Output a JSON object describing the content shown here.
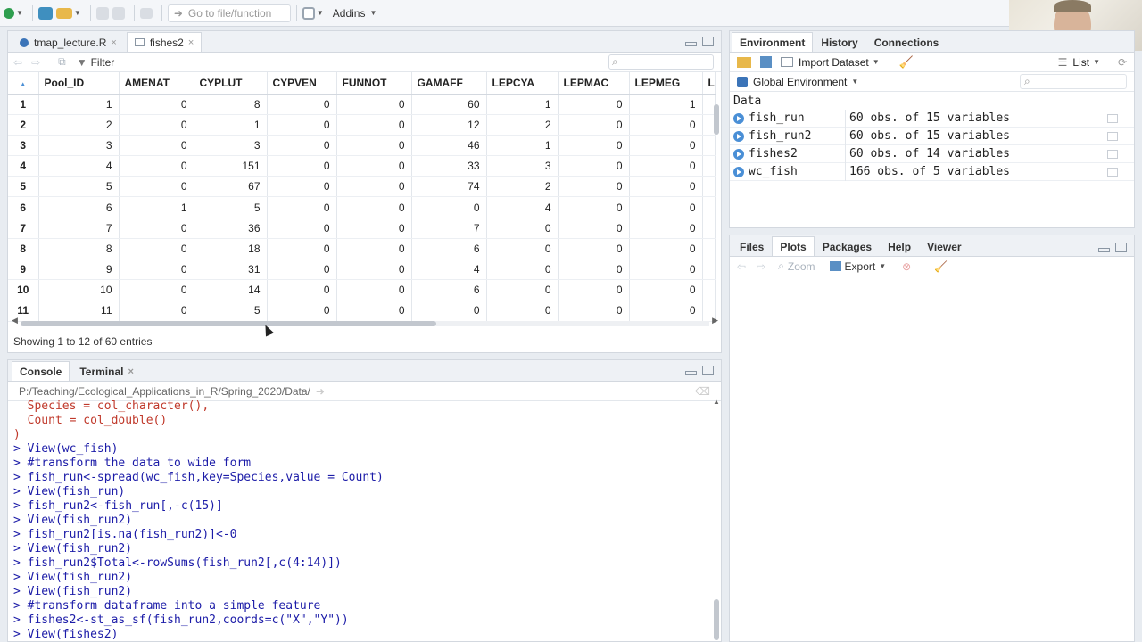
{
  "toolbar": {
    "goto_placeholder": "Go to file/function",
    "addins_label": "Addins"
  },
  "source": {
    "tabs": [
      {
        "label": "tmap_lecture.R",
        "active": false
      },
      {
        "label": "fishes2",
        "active": true
      }
    ],
    "filter_label": "Filter",
    "columns": [
      "Pool_ID",
      "AMENAT",
      "CYPLUT",
      "CYPVEN",
      "FUNNOT",
      "GAMAFF",
      "LEPCYA",
      "LEPMAC",
      "LEPMEG",
      "LEPM"
    ],
    "rows": [
      [
        "1",
        "1",
        "0",
        "8",
        "0",
        "0",
        "60",
        "1",
        "0",
        "1"
      ],
      [
        "2",
        "2",
        "0",
        "1",
        "0",
        "0",
        "12",
        "2",
        "0",
        "0"
      ],
      [
        "3",
        "3",
        "0",
        "3",
        "0",
        "0",
        "46",
        "1",
        "0",
        "0"
      ],
      [
        "4",
        "4",
        "0",
        "151",
        "0",
        "0",
        "33",
        "3",
        "0",
        "0"
      ],
      [
        "5",
        "5",
        "0",
        "67",
        "0",
        "0",
        "74",
        "2",
        "0",
        "0"
      ],
      [
        "6",
        "6",
        "1",
        "5",
        "0",
        "0",
        "0",
        "4",
        "0",
        "0"
      ],
      [
        "7",
        "7",
        "0",
        "36",
        "0",
        "0",
        "7",
        "0",
        "0",
        "0"
      ],
      [
        "8",
        "8",
        "0",
        "18",
        "0",
        "0",
        "6",
        "0",
        "0",
        "0"
      ],
      [
        "9",
        "9",
        "0",
        "31",
        "0",
        "0",
        "4",
        "0",
        "0",
        "0"
      ],
      [
        "10",
        "10",
        "0",
        "14",
        "0",
        "0",
        "6",
        "0",
        "0",
        "0"
      ],
      [
        "11",
        "11",
        "0",
        "5",
        "0",
        "0",
        "0",
        "0",
        "0",
        "0"
      ]
    ],
    "entries_text": "Showing 1 to 12 of 60 entries"
  },
  "console": {
    "tabs": [
      {
        "label": "Console",
        "active": true
      },
      {
        "label": "Terminal",
        "active": false
      }
    ],
    "path": "P:/Teaching/Ecological_Applications_in_R/Spring_2020/Data/",
    "lines": [
      "  Species = col_character(),",
      "  Count = col_double()",
      ")",
      "> View(wc_fish)",
      "> #transform the data to wide form",
      "> fish_run<-spread(wc_fish,key=Species,value = Count)",
      "> View(fish_run)",
      "> fish_run2<-fish_run[,-c(15)]",
      "> View(fish_run2)",
      "> fish_run2[is.na(fish_run2)]<-0",
      "> View(fish_run2)",
      "> fish_run2$Total<-rowSums(fish_run2[,c(4:14)])",
      "> View(fish_run2)",
      "> View(fish_run2)",
      "> #transform dataframe into a simple feature",
      "> fishes2<-st_as_sf(fish_run2,coords=c(\"X\",\"Y\"))",
      "> View(fishes2)"
    ]
  },
  "environment": {
    "tabs": [
      {
        "label": "Environment",
        "active": true
      },
      {
        "label": "History",
        "active": false
      },
      {
        "label": "Connections",
        "active": false
      }
    ],
    "import_label": "Import Dataset",
    "view_mode": "List",
    "scope": "Global Environment",
    "section": "Data",
    "objects": [
      {
        "name": "fish_run",
        "value": "60 obs. of 15 variables"
      },
      {
        "name": "fish_run2",
        "value": "60 obs. of 15 variables"
      },
      {
        "name": "fishes2",
        "value": "60 obs. of 14 variables"
      },
      {
        "name": "wc_fish",
        "value": "166 obs. of 5 variables"
      }
    ]
  },
  "plots": {
    "tabs": [
      {
        "label": "Files",
        "active": false
      },
      {
        "label": "Plots",
        "active": true
      },
      {
        "label": "Packages",
        "active": false
      },
      {
        "label": "Help",
        "active": false
      },
      {
        "label": "Viewer",
        "active": false
      }
    ],
    "zoom_label": "Zoom",
    "export_label": "Export"
  },
  "colors": {
    "console_text": "#1c1ca8",
    "accent": "#4a8fd6"
  }
}
